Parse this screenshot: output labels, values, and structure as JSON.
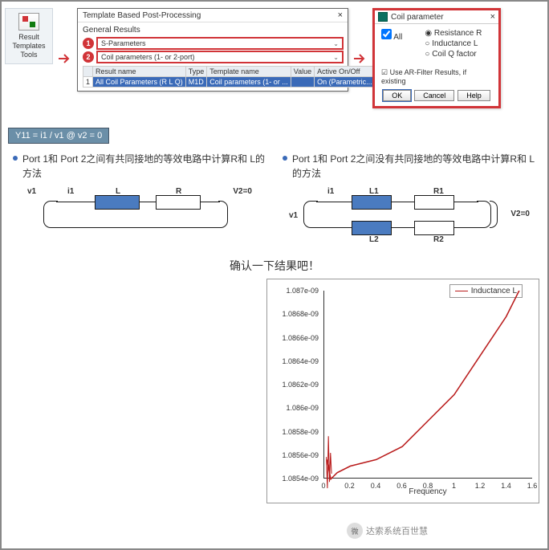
{
  "ribbon": {
    "label": "Result\nTemplates\nTools"
  },
  "arrow1": "→",
  "arrow2": "→",
  "dlg": {
    "title": "Template Based Post-Processing",
    "close": "×",
    "general": "General Results",
    "step1": "1",
    "step2": "2",
    "combo1": "S-Parameters",
    "combo2": "Coil parameters (1- or 2-port)",
    "chev": "⌄",
    "th": {
      "name": "Result name",
      "type": "Type",
      "tmpl": "Template name",
      "value": "Value",
      "on": "Active On/Off"
    },
    "row": {
      "idx": "1",
      "name": "All Coil Parameters (R L Q)",
      "type": "M1D",
      "tmpl": "Coil parameters (1- or ...",
      "value": "",
      "on": "On (Parametric...",
      "chk": "✓"
    }
  },
  "coil": {
    "title": "Coil parameter",
    "close": "×",
    "all": "All",
    "r1": "Resistance R",
    "r2": "Inductance L",
    "r3": "Coil Q factor",
    "ar": "Use AR-Filter Results, if existing",
    "ok": "OK",
    "cancel": "Cancel",
    "help": "Help"
  },
  "formula": "Y11 = i1 / v1 @ v2 = 0",
  "method1": {
    "title": "Port 1和 Port 2之间有共同接地的等效电路中计算R和 L的方法",
    "i1": "i1",
    "L": "L",
    "R": "R",
    "v1": "v1",
    "v2": "V2=0"
  },
  "method2": {
    "title": "Port 1和 Port 2之间没有共同接地的等效电路中计算R和 L的方法",
    "i1": "i1",
    "L1": "L1",
    "R1": "R1",
    "L2": "L2",
    "R2": "R2",
    "v1": "v1",
    "v2": "V2=0"
  },
  "confirm": "确认一下结果吧！",
  "chart_data": {
    "type": "line",
    "title": "",
    "legend": "Inductance L",
    "ylabel": "",
    "xlabel": "Frequency",
    "ylim": [
      1.0854e-09,
      1.087e-09
    ],
    "xlim": [
      0,
      1.6
    ],
    "yticks": [
      "1.087e-09",
      "1.0868e-09",
      "1.0866e-09",
      "1.0864e-09",
      "1.0862e-09",
      "1.086e-09",
      "1.0858e-09",
      "1.0856e-09",
      "1.0854e-09"
    ],
    "xticks": [
      "0",
      "0.2",
      "0.4",
      "0.6",
      "0.8",
      "1",
      "1.2",
      "1.4",
      "1.6"
    ],
    "series": [
      {
        "name": "Inductance L",
        "x": [
          0.02,
          0.05,
          0.1,
          0.2,
          0.4,
          0.6,
          0.8,
          1.0,
          1.2,
          1.4,
          1.5,
          1.6
        ],
        "values": [
          1.0857e-09,
          1.08555e-09,
          1.0856e-09,
          1.08565e-09,
          1.0857e-09,
          1.0858e-09,
          1.086e-09,
          1.0862e-09,
          1.0865e-09,
          1.0868e-09,
          1.087e-09,
          1.0872e-09
        ]
      }
    ]
  },
  "watermark": "达索系统百世慧"
}
